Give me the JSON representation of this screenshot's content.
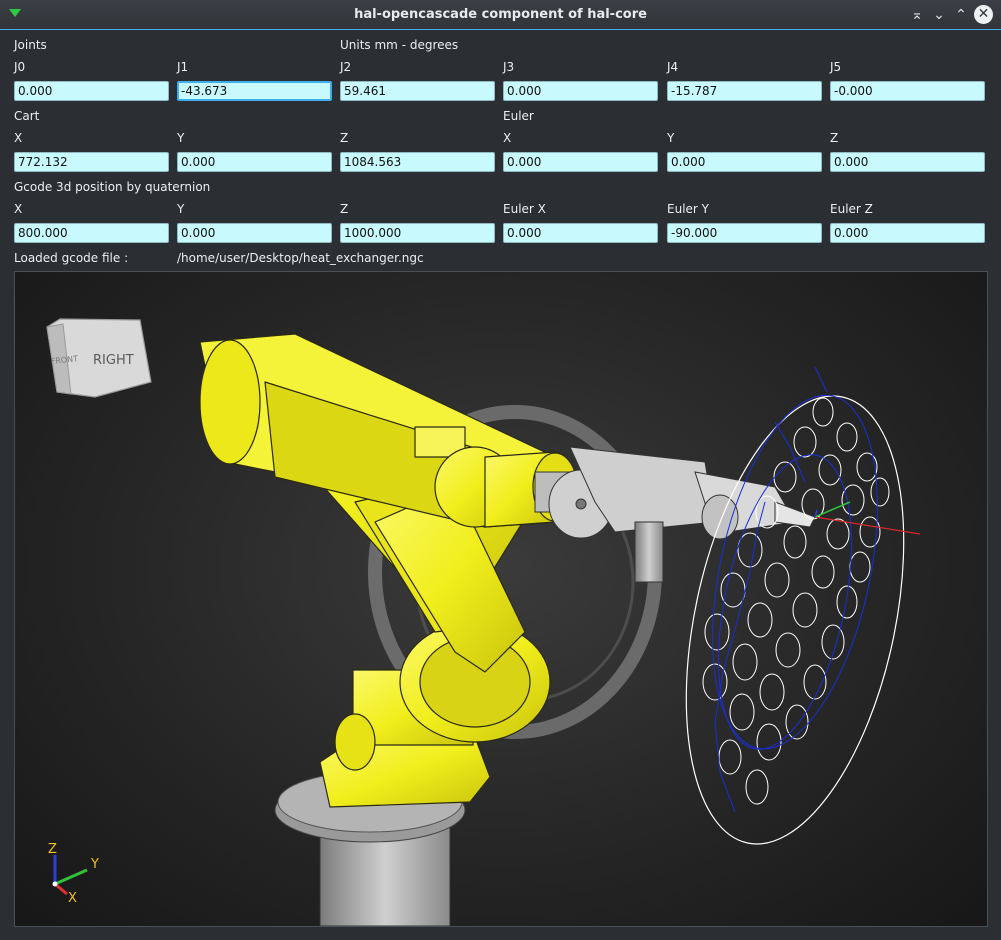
{
  "window": {
    "title": "hal-opencascade component of hal-core",
    "buttons": [
      "keep-above",
      "minimize",
      "maximize",
      "close"
    ]
  },
  "joints": {
    "section_label": "Joints",
    "units_label": "Units mm - degrees",
    "fields": [
      {
        "label": "J0",
        "value": "0.000"
      },
      {
        "label": "J1",
        "value": "-43.673"
      },
      {
        "label": "J2",
        "value": "59.461"
      },
      {
        "label": "J3",
        "value": "0.000"
      },
      {
        "label": "J4",
        "value": "-15.787"
      },
      {
        "label": "J5",
        "value": "-0.000"
      }
    ]
  },
  "cart": {
    "section_label": "Cart",
    "euler_label": "Euler",
    "fields": [
      {
        "label": "X",
        "value": "772.132"
      },
      {
        "label": "Y",
        "value": "0.000"
      },
      {
        "label": "Z",
        "value": "1084.563"
      },
      {
        "label": "X",
        "value": "0.000"
      },
      {
        "label": "Y",
        "value": "0.000"
      },
      {
        "label": "Z",
        "value": "0.000"
      }
    ]
  },
  "gcode": {
    "section_label": "Gcode 3d position by quaternion",
    "fields": [
      {
        "label": "X",
        "value": "800.000"
      },
      {
        "label": "Y",
        "value": "0.000"
      },
      {
        "label": "Z",
        "value": "1000.000"
      },
      {
        "label": "Euler X",
        "value": "0.000"
      },
      {
        "label": "Euler Y",
        "value": "-90.000"
      },
      {
        "label": "Euler Z",
        "value": "0.000"
      }
    ]
  },
  "loaded_file": {
    "label": "Loaded gcode file :",
    "path": "/home/user/Desktop/heat_exchanger.ngc"
  },
  "viewport": {
    "view_cube_label": "RIGHT",
    "view_cube_side_label": "FRONT",
    "triad": {
      "x": "X",
      "y": "Y",
      "z": "Z"
    },
    "colors": {
      "robot": "#f1ee1c",
      "toolpath": "#1a2fd6",
      "plate": "#ffffff",
      "triad_x": "#e23030",
      "triad_y": "#2fc23a",
      "triad_z": "#2b3fe0"
    }
  }
}
